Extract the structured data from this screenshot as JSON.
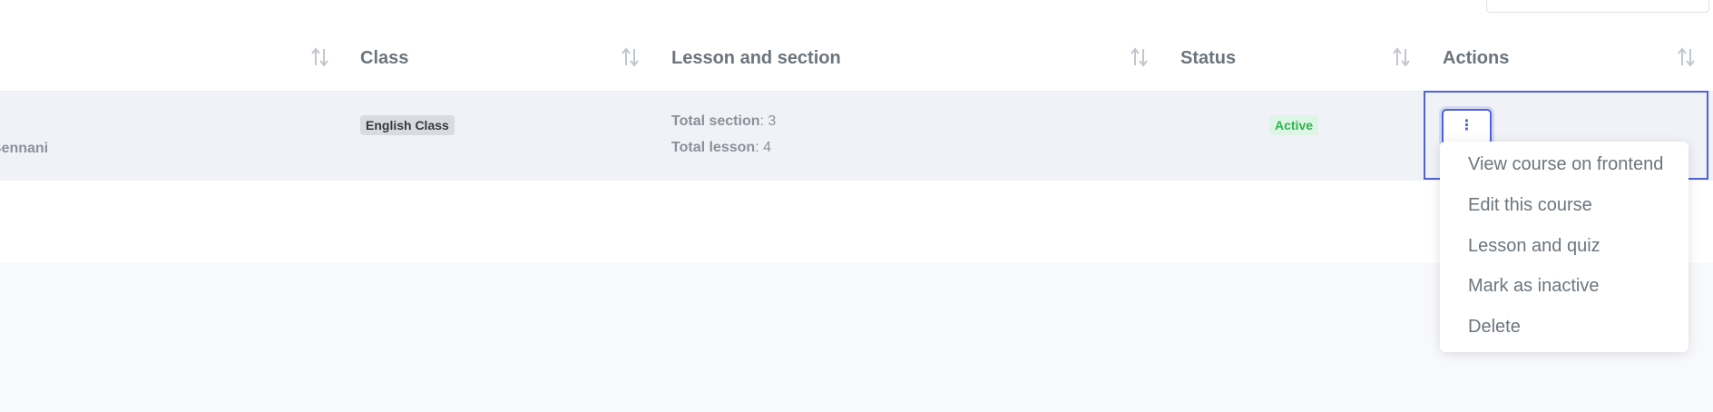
{
  "table": {
    "columns": [
      {
        "label": ""
      },
      {
        "label": "Class"
      },
      {
        "label": "Lesson and section"
      },
      {
        "label": "Status"
      },
      {
        "label": "Actions"
      }
    ],
    "row": {
      "instructor_fragment": "Bennani",
      "class_badge": "English Class",
      "total_section_label": "Total section",
      "total_section_value": ": 3",
      "total_lesson_label": "Total lesson",
      "total_lesson_value": ": 4",
      "status": "Active",
      "actions_button": "⋮"
    }
  },
  "actions_menu": {
    "items": [
      "View course on frontend",
      "Edit this course",
      "Lesson and quiz",
      "Mark as inactive",
      "Delete"
    ]
  },
  "colors": {
    "accent": "#4e63d7",
    "status_active_text": "#2fb451",
    "status_active_bg": "#dcf5e4",
    "row_highlight": "#f0f2f7"
  }
}
